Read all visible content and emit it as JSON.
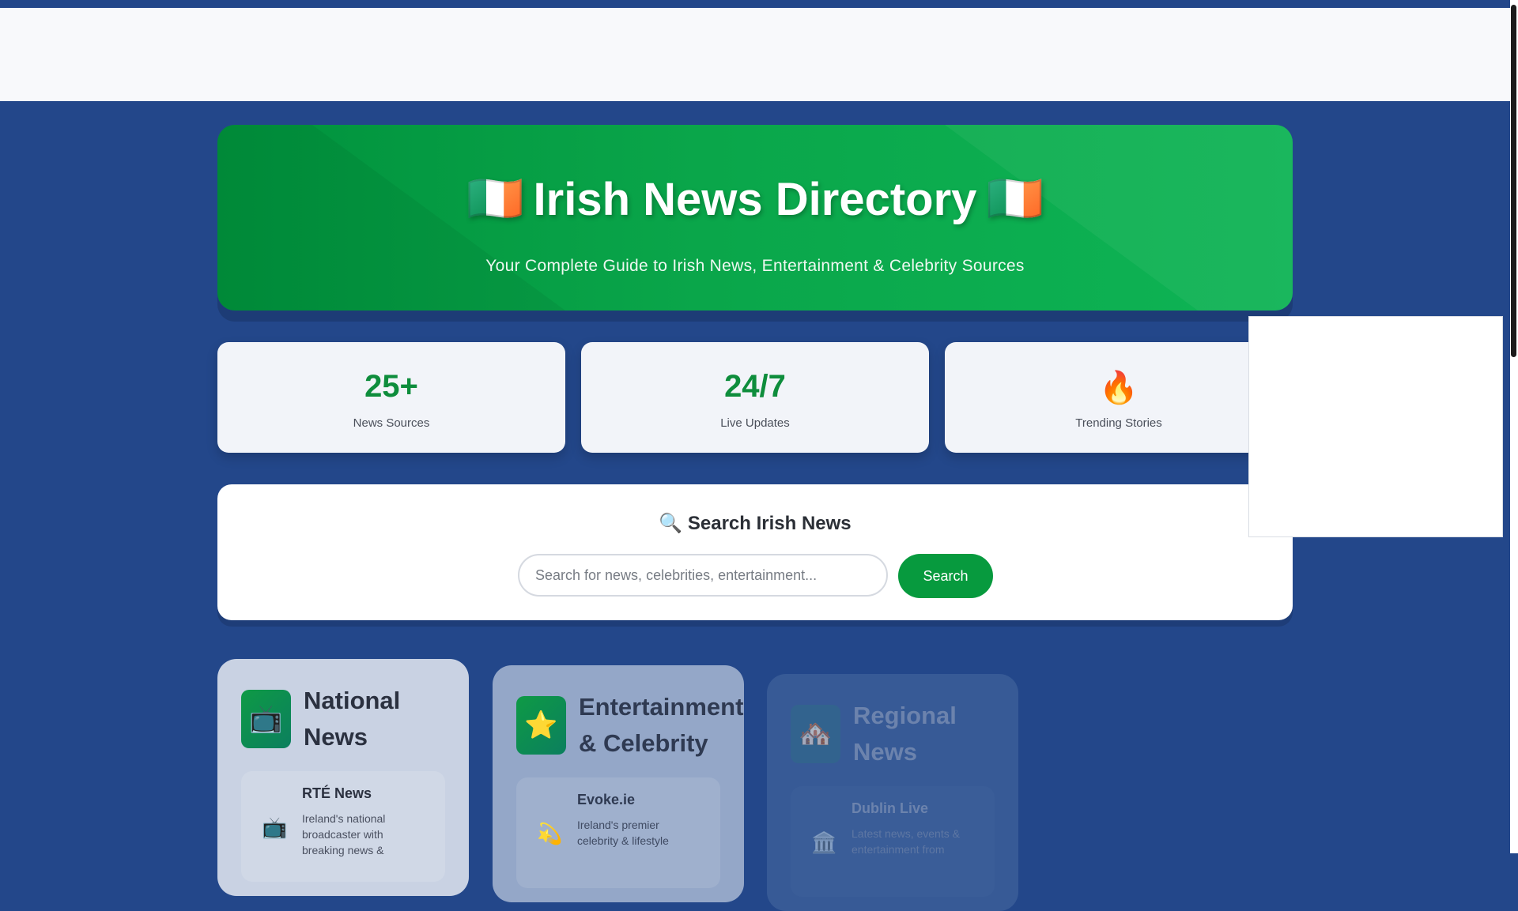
{
  "hero": {
    "title": "Irish News Directory",
    "flag_icon": "🇮🇪",
    "subtitle": "Your Complete Guide to Irish News, Entertainment & Celebrity Sources"
  },
  "stats": [
    {
      "value": "25+",
      "label": "News Sources"
    },
    {
      "value": "24/7",
      "label": "Live Updates"
    },
    {
      "value": "🔥",
      "label": "Trending Stories"
    }
  ],
  "search": {
    "heading": "🔍 Search Irish News",
    "placeholder": "Search for news, celebrities, entertainment...",
    "button_label": "Search"
  },
  "categories": [
    {
      "icon": "📺",
      "title_line1": "National",
      "title_line2": "News",
      "source": {
        "icon": "📺",
        "name": "RTÉ News",
        "description": "Ireland's national broadcaster with breaking news &"
      }
    },
    {
      "icon": "⭐",
      "title_line1": "Entertainment",
      "title_line2": "& Celebrity",
      "source": {
        "icon": "💫",
        "name": "Evoke.ie",
        "description": "Ireland's premier celebrity & lifestyle"
      }
    },
    {
      "icon": "🏘️",
      "title_line1": "Regional",
      "title_line2": "News",
      "source": {
        "icon": "🏛️",
        "name": "Dublin Live",
        "description": "Latest news, events & entertainment from"
      }
    }
  ],
  "colors": {
    "page_bg": "#23478a",
    "accent_green": "#079a3e",
    "stat_value": "#0e8d3c"
  }
}
